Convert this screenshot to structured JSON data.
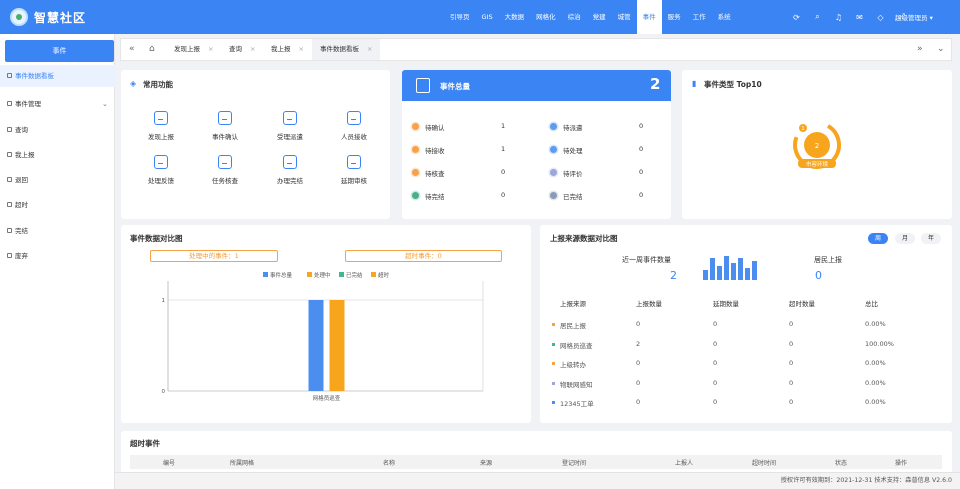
{
  "app": {
    "title": "智慧社区"
  },
  "topnav": [
    {
      "label": "引导页",
      "active": false
    },
    {
      "label": "GIS",
      "active": false
    },
    {
      "label": "大数据",
      "active": false
    },
    {
      "label": "网格化",
      "active": false
    },
    {
      "label": "综治",
      "active": false
    },
    {
      "label": "党建",
      "active": false
    },
    {
      "label": "城管",
      "active": false
    },
    {
      "label": "事件",
      "active": true
    },
    {
      "label": "服务",
      "active": false
    },
    {
      "label": "工作",
      "active": false
    },
    {
      "label": "系统",
      "active": false
    }
  ],
  "user": {
    "name": "超级管理员"
  },
  "sidebar": {
    "title": "事件",
    "items": [
      {
        "label": "事件数据看板",
        "active": true
      },
      {
        "label": "事件管理",
        "active": false
      },
      {
        "label": "查询",
        "active": false
      },
      {
        "label": "我上报",
        "active": false
      },
      {
        "label": "退回",
        "active": false
      },
      {
        "label": "超时",
        "active": false
      },
      {
        "label": "完结",
        "active": false
      },
      {
        "label": "废弃",
        "active": false
      }
    ]
  },
  "tabs": [
    {
      "label": "发现上报",
      "active": false
    },
    {
      "label": "查询",
      "active": false
    },
    {
      "label": "我上报",
      "active": false
    },
    {
      "label": "事件数据看板",
      "active": true
    }
  ],
  "functions": {
    "title": "常用功能",
    "items": [
      {
        "label": "发现上报",
        "icon": "pencil-icon"
      },
      {
        "label": "事件确认",
        "icon": "user-check-icon"
      },
      {
        "label": "受理派遣",
        "icon": "clipboard-icon"
      },
      {
        "label": "人员接收",
        "icon": "file-check-icon"
      },
      {
        "label": "处理反馈",
        "icon": "document-icon"
      },
      {
        "label": "任务核查",
        "icon": "person-search-icon"
      },
      {
        "label": "办理完结",
        "icon": "share-icon"
      },
      {
        "label": "延期审核",
        "icon": "clock-icon"
      }
    ]
  },
  "summary": {
    "title": "事件总量",
    "total": "2",
    "items": [
      {
        "label": "待确认",
        "value": "1",
        "color": "#f6a24b"
      },
      {
        "label": "待派遣",
        "value": "0",
        "color": "#5b9bf0"
      },
      {
        "label": "待接收",
        "value": "1",
        "color": "#f6a24b"
      },
      {
        "label": "待处理",
        "value": "0",
        "color": "#5b9bf0"
      },
      {
        "label": "待核查",
        "value": "0",
        "color": "#f6a24b"
      },
      {
        "label": "待评价",
        "value": "0",
        "color": "#9aa6dc"
      },
      {
        "label": "待完结",
        "value": "0",
        "color": "#4caf8a"
      },
      {
        "label": "已完结",
        "value": "0",
        "color": "#8a9bb8"
      }
    ]
  },
  "top10": {
    "title": "事件类型 Top10",
    "rank": "1",
    "count": "2",
    "label": "市容环境",
    "color": "#f7a51c"
  },
  "compare": {
    "title": "事件数据对比图",
    "processing": "处理中的事件：1",
    "overtime": "超时事件：0"
  },
  "chart_data": {
    "type": "bar",
    "categories": [
      "网格员巡查"
    ],
    "series": [
      {
        "name": "事件总量",
        "values": [
          1
        ],
        "color": "#4b8ef0"
      },
      {
        "name": "处理中",
        "values": [
          1
        ],
        "color": "#f7a51c"
      },
      {
        "name": "已完结",
        "values": [
          0
        ],
        "color": "#3fb98a"
      },
      {
        "name": "超时",
        "values": [
          0
        ],
        "color": "#f7a51c"
      }
    ],
    "yticks": [
      "0",
      "1"
    ],
    "ylim": [
      0,
      1
    ],
    "legend": "top-center"
  },
  "source": {
    "title": "上报来源数据对比图",
    "periods": [
      {
        "label": "周",
        "active": true
      },
      {
        "label": "月",
        "active": false
      },
      {
        "label": "年",
        "active": false
      }
    ],
    "week_label": "近一周事件数量",
    "week_value": "2",
    "week_bars": [
      0.4,
      0.9,
      0.6,
      1.0,
      0.7,
      0.9,
      0.5,
      0.8
    ],
    "resident_label": "居民上报",
    "resident_value": "0",
    "columns": [
      "上报来源",
      "上报数量",
      "延期数量",
      "超时数量",
      "总比"
    ],
    "rows": [
      {
        "name": "居民上报",
        "report": "0",
        "delay": "0",
        "overtime": "0",
        "ratio": "0.00%",
        "color": "#f6a24b"
      },
      {
        "name": "网格员巡查",
        "report": "2",
        "delay": "0",
        "overtime": "0",
        "ratio": "100.00%",
        "color": "#3fb98a"
      },
      {
        "name": "上级转办",
        "report": "0",
        "delay": "0",
        "overtime": "0",
        "ratio": "0.00%",
        "color": "#f6a24b"
      },
      {
        "name": "物联网感知",
        "report": "0",
        "delay": "0",
        "overtime": "0",
        "ratio": "0.00%",
        "color": "#9aa6dc"
      },
      {
        "name": "12345工单",
        "report": "0",
        "delay": "0",
        "overtime": "0",
        "ratio": "0.00%",
        "color": "#4b8ef0"
      }
    ]
  },
  "overtime_events": {
    "title": "超时事件",
    "columns": [
      "编号",
      "所属网格",
      "名称",
      "来源",
      "登记时间",
      "上报人",
      "超时时间",
      "状态",
      "操作"
    ]
  },
  "footer": {
    "text": "授权许可有效期到：2021-12-31  技术支持：森普信息  V2.6.0"
  }
}
